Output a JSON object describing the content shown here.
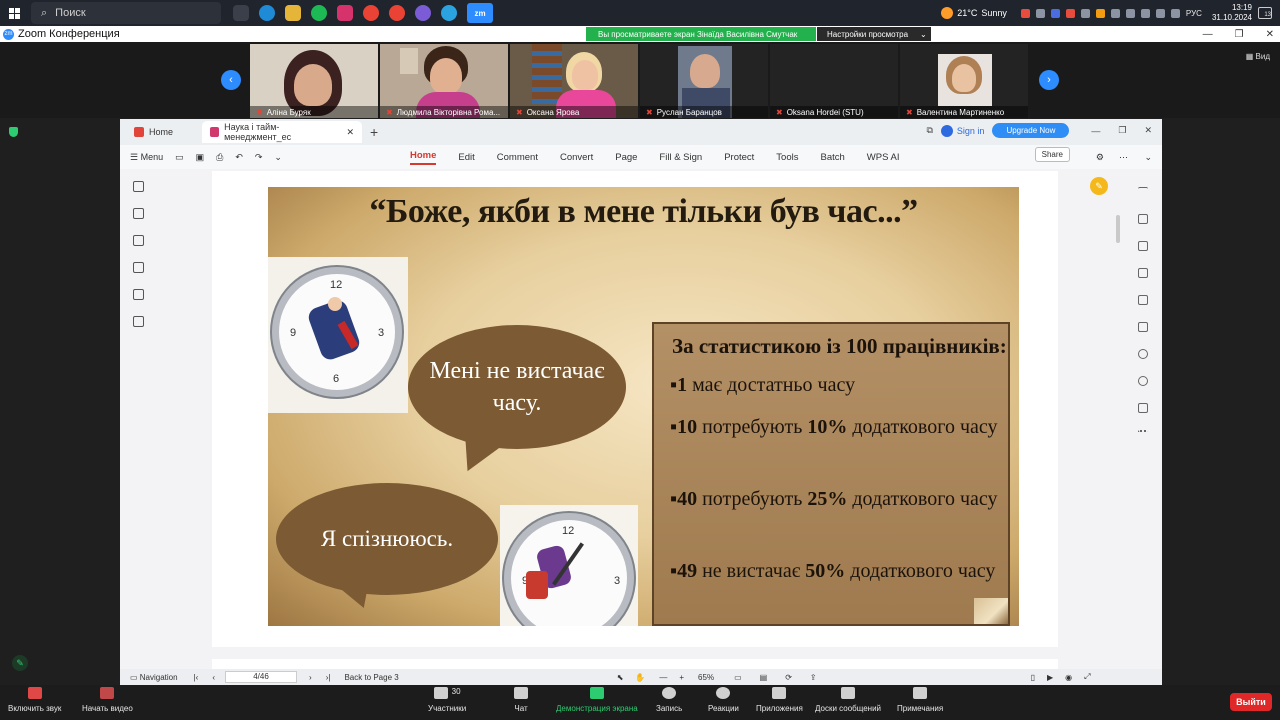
{
  "taskbar": {
    "search_label": "Поиск",
    "weather_temp": "21°C",
    "weather_text": "Sunny",
    "lang": "РУС",
    "time": "13:19",
    "date": "31.10.2024",
    "notif_count": "13",
    "zoom_app": "zm"
  },
  "zoom": {
    "title": "Zoom Конференция",
    "share_banner": "Вы просматриваете экран Зінаїда Василівна Смутчак",
    "view_options": "Настройки просмотра",
    "view_button": "Вид",
    "participants": [
      "Аліна Буряк",
      "Людмила Вікторівна Рома...",
      "Оксана Ярова",
      "Руслан Баранцов",
      "Oksana Hordei (STU)",
      "Валентина Мартиненко"
    ],
    "toolbar": {
      "audio": "Включить звук",
      "video": "Начать видео",
      "participants": "Участники",
      "participants_count": "30",
      "chat": "Чат",
      "share": "Демонстрация экрана",
      "record": "Запись",
      "reactions": "Реакции",
      "apps": "Приложения",
      "whiteboards": "Доски сообщений",
      "notes": "Примечания",
      "leave": "Выйти"
    }
  },
  "wps": {
    "tab_home": "Home",
    "tab_doc": "Наука і тайм-менеджмент_ес",
    "sign_in": "Sign in",
    "upgrade": "Upgrade Now",
    "menu_label": "Menu",
    "share": "Share",
    "menu": [
      "Home",
      "Edit",
      "Comment",
      "Convert",
      "Page",
      "Fill & Sign",
      "Protect",
      "Tools",
      "Batch",
      "WPS AI"
    ],
    "status": {
      "navigation": "Navigation",
      "page": "4/46",
      "back": "Back to Page 3",
      "zoom": "65%"
    }
  },
  "slide": {
    "title": "“Боже, якби в мене тільки був час...”",
    "bubble1": "Мені не вистачає часу.",
    "bubble2": "Я спізнююсь.",
    "stats_head": "За статистикою із 100 працівників:",
    "stats": [
      {
        "num": "▪1",
        "text": " має достатньо часу"
      },
      {
        "num": "▪10",
        "text": " потребують ",
        "pct": "10%",
        "rest": " додаткового часу"
      },
      {
        "num": "▪40",
        "text": " потребують ",
        "pct": "25%",
        "rest": " додаткового часу"
      },
      {
        "num": "▪49",
        "text": " не вистачає ",
        "pct": "50%",
        "rest": " додаткового часу"
      }
    ],
    "clock_numbers": [
      "12",
      "3",
      "6",
      "9"
    ]
  }
}
